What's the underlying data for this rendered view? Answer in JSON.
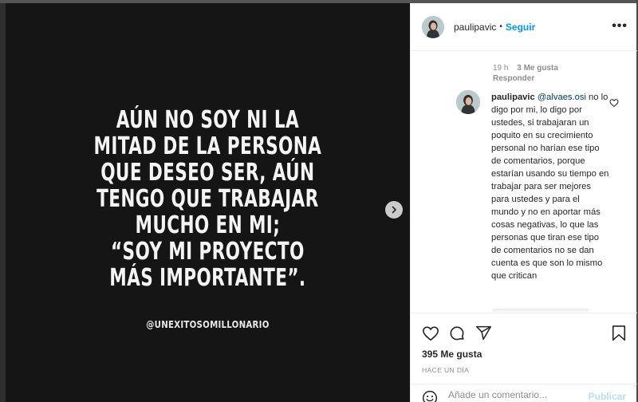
{
  "post": {
    "image_quote_lines": [
      "AÚN NO SOY NI LA",
      "MITAD DE LA PERSONA",
      "QUE DESEO SER, AÚN",
      "TENGO QUE TRABAJAR",
      "MUCHO EN MI;",
      "“SOY MI PROYECTO",
      "MÁS IMPORTANTE”."
    ],
    "image_credit": "@UNEXITOSOMILLONARIO",
    "next_icon": "chevron-right-icon"
  },
  "header": {
    "username": "paulipavic",
    "dot": "•",
    "follow_label": "Seguir",
    "more_icon": "ellipsis-icon",
    "more_label": "•••"
  },
  "comments": {
    "meta": {
      "time": "19 h",
      "likes": "3 Me gusta",
      "reply_label": "Responder"
    },
    "reply": {
      "username": "paulipavic",
      "mention": "@alvaes.osi",
      "text": " no lo digo por mi, lo digo por ustedes, si trabajaran un poquito en su crecimiento personal no harían ese tipo de comentarios, porque estarían usando su tiempo en trabajar para ser mejores para ustedes y para el mundo y no en aportar más cosas negativas, lo que las personas que tiran ese tipo de comentarios no se dan cuenta es que son lo mismo que critican"
    }
  },
  "actions": {
    "like_icon": "heart-icon",
    "comment_icon": "comment-icon",
    "share_icon": "share-icon",
    "save_icon": "bookmark-icon",
    "likes_count": "395 Me gusta",
    "time_ago": "HACE UN DÍA"
  },
  "add_comment": {
    "emoji_icon": "emoji-icon",
    "placeholder": "Añade un comentario...",
    "post_label": "Publicar"
  },
  "colors": {
    "accent": "#0095f6",
    "post_disabled": "#b2dffc",
    "media_bg": "#151515",
    "text_primary": "#262626",
    "text_secondary": "#8e8e8e"
  }
}
